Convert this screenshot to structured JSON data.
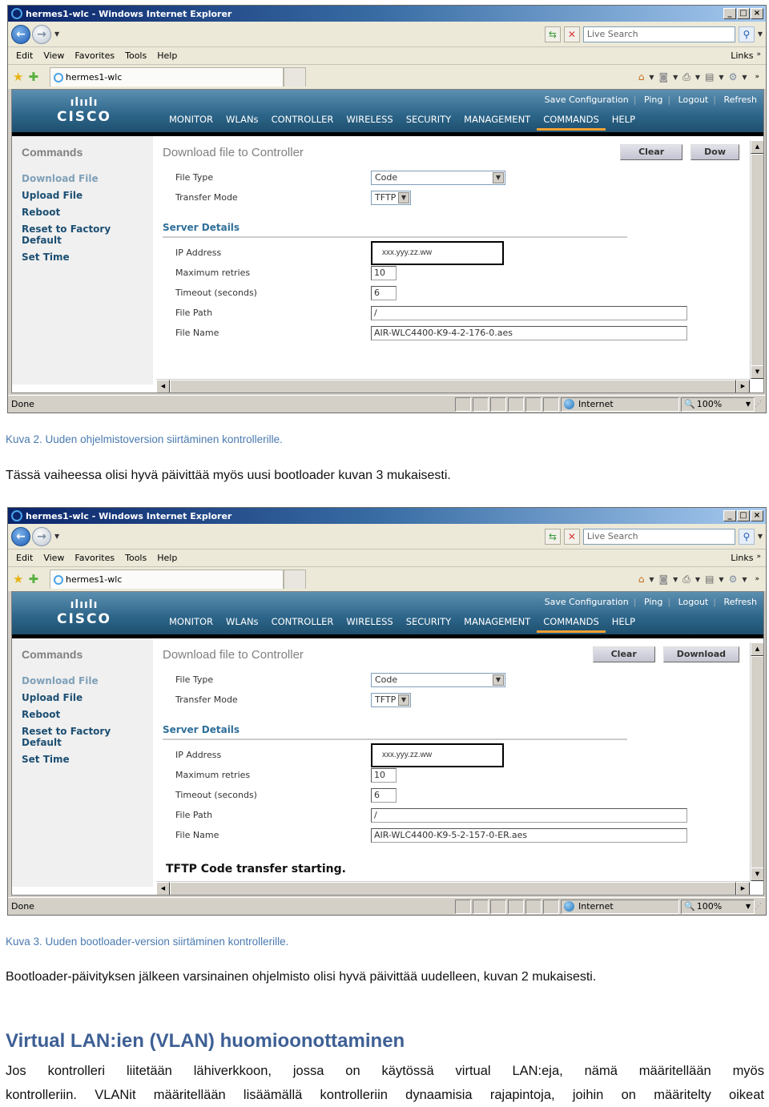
{
  "screens": [
    {
      "window_title": "hermes1-wlc - Windows Internet Explorer",
      "search_placeholder": "Live Search",
      "menu": [
        "Edit",
        "View",
        "Favorites",
        "Tools",
        "Help"
      ],
      "links_label": "Links",
      "tab_title": "hermes1-wlc",
      "top_links": [
        "Save Configuration",
        "Ping",
        "Logout",
        "Refresh"
      ],
      "nav": [
        "MONITOR",
        "WLANs",
        "CONTROLLER",
        "WIRELESS",
        "SECURITY",
        "MANAGEMENT",
        "COMMANDS",
        "HELP"
      ],
      "active_nav": "COMMANDS",
      "logo_text": "CISCO",
      "sidebar_title": "Commands",
      "sidebar_items": [
        "Download File",
        "Upload File",
        "Reboot",
        "Reset to Factory Default",
        "Set Time"
      ],
      "page_title": "Download file to Controller",
      "buttons": {
        "clear": "Clear",
        "download": "Dow"
      },
      "fields": {
        "file_type_label": "File Type",
        "file_type_value": "Code",
        "transfer_mode_label": "Transfer Mode",
        "transfer_mode_value": "TFTP",
        "section_title": "Server Details",
        "ip_label": "IP Address",
        "ip_value": "xxx.yyy.zz.ww",
        "retries_label": "Maximum retries",
        "retries_value": "10",
        "timeout_label": "Timeout (seconds)",
        "timeout_value": "6",
        "path_label": "File Path",
        "path_value": "/",
        "name_label": "File Name",
        "name_value": "AIR-WLC4400-K9-4-2-176-0.aes"
      },
      "status_message": "",
      "statusbar": {
        "text": "Done",
        "zone": "Internet",
        "zoom": "100%"
      }
    },
    {
      "window_title": "hermes1-wlc - Windows Internet Explorer",
      "search_placeholder": "Live Search",
      "menu": [
        "Edit",
        "View",
        "Favorites",
        "Tools",
        "Help"
      ],
      "links_label": "Links",
      "tab_title": "hermes1-wlc",
      "top_links": [
        "Save Configuration",
        "Ping",
        "Logout",
        "Refresh"
      ],
      "nav": [
        "MONITOR",
        "WLANs",
        "CONTROLLER",
        "WIRELESS",
        "SECURITY",
        "MANAGEMENT",
        "COMMANDS",
        "HELP"
      ],
      "active_nav": "COMMANDS",
      "logo_text": "CISCO",
      "sidebar_title": "Commands",
      "sidebar_items": [
        "Download File",
        "Upload File",
        "Reboot",
        "Reset to Factory Default",
        "Set Time"
      ],
      "page_title": "Download file to Controller",
      "buttons": {
        "clear": "Clear",
        "download": "Download"
      },
      "fields": {
        "file_type_label": "File Type",
        "file_type_value": "Code",
        "transfer_mode_label": "Transfer Mode",
        "transfer_mode_value": "TFTP",
        "section_title": "Server Details",
        "ip_label": "IP Address",
        "ip_value": "xxx.yyy.zz.ww",
        "retries_label": "Maximum retries",
        "retries_value": "10",
        "timeout_label": "Timeout (seconds)",
        "timeout_value": "6",
        "path_label": "File Path",
        "path_value": "/",
        "name_label": "File Name",
        "name_value": "AIR-WLC4400-K9-5-2-157-0-ER.aes"
      },
      "status_message": "TFTP Code transfer starting.",
      "statusbar": {
        "text": "Done",
        "zone": "Internet",
        "zoom": "100%"
      }
    }
  ],
  "document": {
    "caption2": "Kuva 2. Uuden ohjelmistoversion siirtäminen kontrollerille.",
    "para1": "Tässä vaiheessa olisi hyvä päivittää myös uusi bootloader kuvan 3 mukaisesti.",
    "caption3": "Kuva 3. Uuden bootloader-version siirtäminen kontrollerille.",
    "para2": "Bootloader-päivityksen jälkeen varsinainen ohjelmisto olisi hyvä päivittää uudelleen, kuvan 2 mukaisesti.",
    "heading": "Virtual LAN:ien (VLAN) huomioonottaminen",
    "body_line1": "Jos kontrolleri liitetään lähiverkkoon, jossa on käytössä virtual LAN:eja, nämä määritellään myös",
    "body_line2": "kontrolleriin. VLANit määritellään lisäämällä kontrolleriin dynaamisia rajapintoja, joihin on määritelty oikeat"
  },
  "colors": {
    "cisco_header": "#2c6589",
    "active_nav_underline": "#f5a133",
    "caption": "#4a7ab0",
    "heading": "#3d5f94",
    "sidebar_link": "#1d4f73"
  }
}
